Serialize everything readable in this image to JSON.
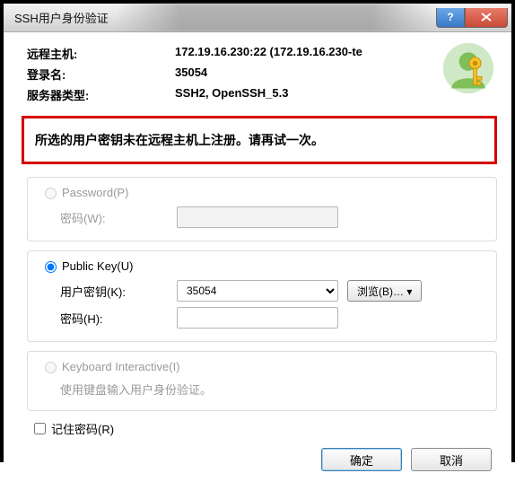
{
  "title": "SSH用户身份验证",
  "info": {
    "remote_host_label": "远程主机:",
    "remote_host_value": "172.19.16.230:22 (172.19.16.230-te",
    "login_label": "登录名:",
    "login_value": "35054",
    "server_type_label": "服务器类型:",
    "server_type_value": "SSH2, OpenSSH_5.3"
  },
  "error": "所选的用户密钥未在远程主机上注册。请再试一次。",
  "auth": {
    "password_radio": "Password(P)",
    "password_field_label": "密码(W):",
    "publickey_radio": "Public Key(U)",
    "user_key_label": "用户密钥(K):",
    "user_key_value": "35054",
    "browse_label": "浏览(B)… ▾",
    "pk_pass_label": "密码(H):",
    "pk_pass_value": "",
    "kbd_radio": "Keyboard Interactive(I)",
    "kbd_hint": "使用键盘输入用户身份验证。"
  },
  "remember_label": "记住密码(R)",
  "buttons": {
    "ok": "确定",
    "cancel": "取消"
  }
}
